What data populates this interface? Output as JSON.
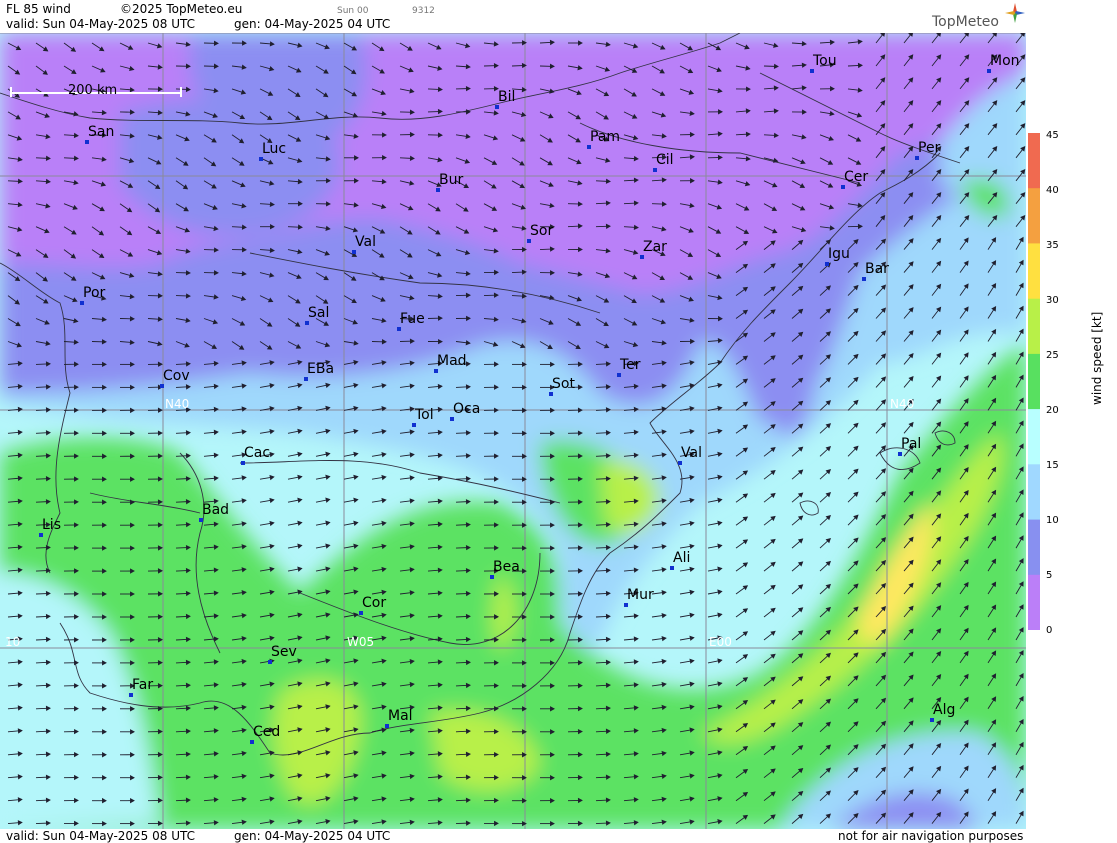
{
  "header": {
    "product": "FL 85 wind",
    "copyright": "©2025 TopMeteo.eu",
    "valid": "valid:  Sun  04-May-2025  08 UTC",
    "gen": "gen: 04-May-2025 04 UTC",
    "step_label": "Sun 00",
    "code": "9312",
    "logo_text": "TopMeteo"
  },
  "footer": {
    "valid": "valid:  Sun  04-May-2025  08 UTC",
    "gen": "gen: 04-May-2025 04 UTC",
    "disclaimer": "not for air navigation purposes"
  },
  "scale_bar": {
    "label": "200 km"
  },
  "grid_labels": {
    "lat_left": "N40",
    "lat_right": "N40",
    "lon_w10": "10",
    "lon_w05": "W05",
    "lon_e00": "E00"
  },
  "legend": {
    "title": "wind speed [kt]",
    "ticks": [
      "45",
      "40",
      "35",
      "30",
      "25",
      "20",
      "15",
      "10",
      "5",
      "0"
    ],
    "colors": [
      "#f06a50",
      "#f4a040",
      "#ffe040",
      "#b8f048",
      "#58e060",
      "#b8ffff",
      "#a0d8ff",
      "#8890f0",
      "#bb7ff8"
    ]
  },
  "cities": [
    {
      "name": "San"
    },
    {
      "name": "Bil"
    },
    {
      "name": "Tou"
    },
    {
      "name": "Mon"
    },
    {
      "name": "Luc"
    },
    {
      "name": "Pam"
    },
    {
      "name": "Cil"
    },
    {
      "name": "Per"
    },
    {
      "name": "Bur"
    },
    {
      "name": "Cer"
    },
    {
      "name": "Sor"
    },
    {
      "name": "Val"
    },
    {
      "name": "Zar"
    },
    {
      "name": "Igu"
    },
    {
      "name": "Bar"
    },
    {
      "name": "Por"
    },
    {
      "name": "Sal"
    },
    {
      "name": "Fue"
    },
    {
      "name": "Mad"
    },
    {
      "name": "Cov"
    },
    {
      "name": "EBa"
    },
    {
      "name": "Sot"
    },
    {
      "name": "Ter"
    },
    {
      "name": "Tol"
    },
    {
      "name": "Oca"
    },
    {
      "name": "Pal"
    },
    {
      "name": "Cac"
    },
    {
      "name": "Val"
    },
    {
      "name": "Bad"
    },
    {
      "name": "Lis"
    },
    {
      "name": "Bea"
    },
    {
      "name": "Ali"
    },
    {
      "name": "Cor"
    },
    {
      "name": "Mur"
    },
    {
      "name": "Sev"
    },
    {
      "name": "Far"
    },
    {
      "name": "Mal"
    },
    {
      "name": "Alg"
    },
    {
      "name": "Ced"
    }
  ]
}
